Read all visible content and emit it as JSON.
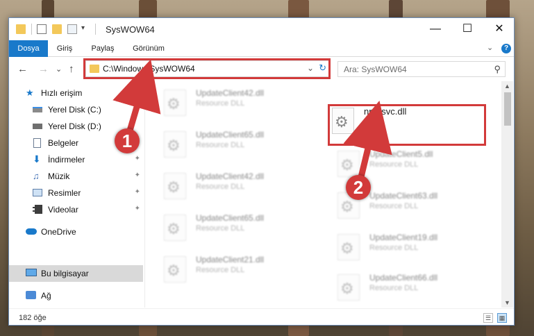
{
  "window": {
    "title": "SysWOW64",
    "minimize": "—",
    "maximize": "☐",
    "close": "✕"
  },
  "ribbon": {
    "tabs": [
      "Dosya",
      "Giriş",
      "Paylaş",
      "Görünüm"
    ],
    "collapse": "⌄"
  },
  "nav": {
    "back": "←",
    "forward": "→",
    "recent": "⌄",
    "up": "↑"
  },
  "address": {
    "path": "C:\\Windows\\SysWOW64",
    "dropdown": "⌄",
    "refresh": "↻"
  },
  "search": {
    "placeholder": "Ara: SysWOW64",
    "icon": "⚲"
  },
  "sidebar": {
    "items": [
      {
        "label": "Hızlı erişim",
        "icon": "star-icon"
      },
      {
        "label": "Yerel Disk (C:)",
        "icon": "drive-icon"
      },
      {
        "label": "Yerel Disk (D:)",
        "icon": "drive-icon"
      },
      {
        "label": "Belgeler",
        "icon": "document-icon"
      },
      {
        "label": "İndirmeler",
        "icon": "download-icon"
      },
      {
        "label": "Müzik",
        "icon": "music-icon"
      },
      {
        "label": "Resimler",
        "icon": "pictures-icon"
      },
      {
        "label": "Videolar",
        "icon": "video-icon"
      },
      {
        "label": "OneDrive",
        "icon": "cloud-icon"
      },
      {
        "label": "Bu bilgisayar",
        "icon": "computer-icon"
      },
      {
        "label": "Ağ",
        "icon": "network-icon"
      }
    ],
    "pin_glyph": "📌"
  },
  "files": {
    "left": [
      {
        "name": "UpdateClient42.dll",
        "type": "Resource DLL"
      },
      {
        "name": "UpdateClient65.dll",
        "type": "Resource DLL"
      },
      {
        "name": "UpdateClient42.dll",
        "type": "Resource DLL"
      },
      {
        "name": "UpdateClient65.dll",
        "type": "Resource DLL"
      },
      {
        "name": "UpdateClient21.dll",
        "type": "Resource DLL"
      }
    ],
    "right": [
      {
        "name": "nntpsvc.dll",
        "type": ""
      },
      {
        "name": "UpdateClient5.dll",
        "type": "Resource DLL"
      },
      {
        "name": "UpdateClient63.dll",
        "type": "Resource DLL"
      },
      {
        "name": "UpdateClient19.dll",
        "type": "Resource DLL"
      },
      {
        "name": "UpdateClient66.dll",
        "type": "Resource DLL"
      }
    ]
  },
  "status": {
    "count": "182 öğe"
  },
  "callouts": {
    "one": "1",
    "two": "2"
  },
  "colors": {
    "accent": "#1979ca",
    "highlight": "#d23a3a",
    "folder": "#f3c85a"
  }
}
